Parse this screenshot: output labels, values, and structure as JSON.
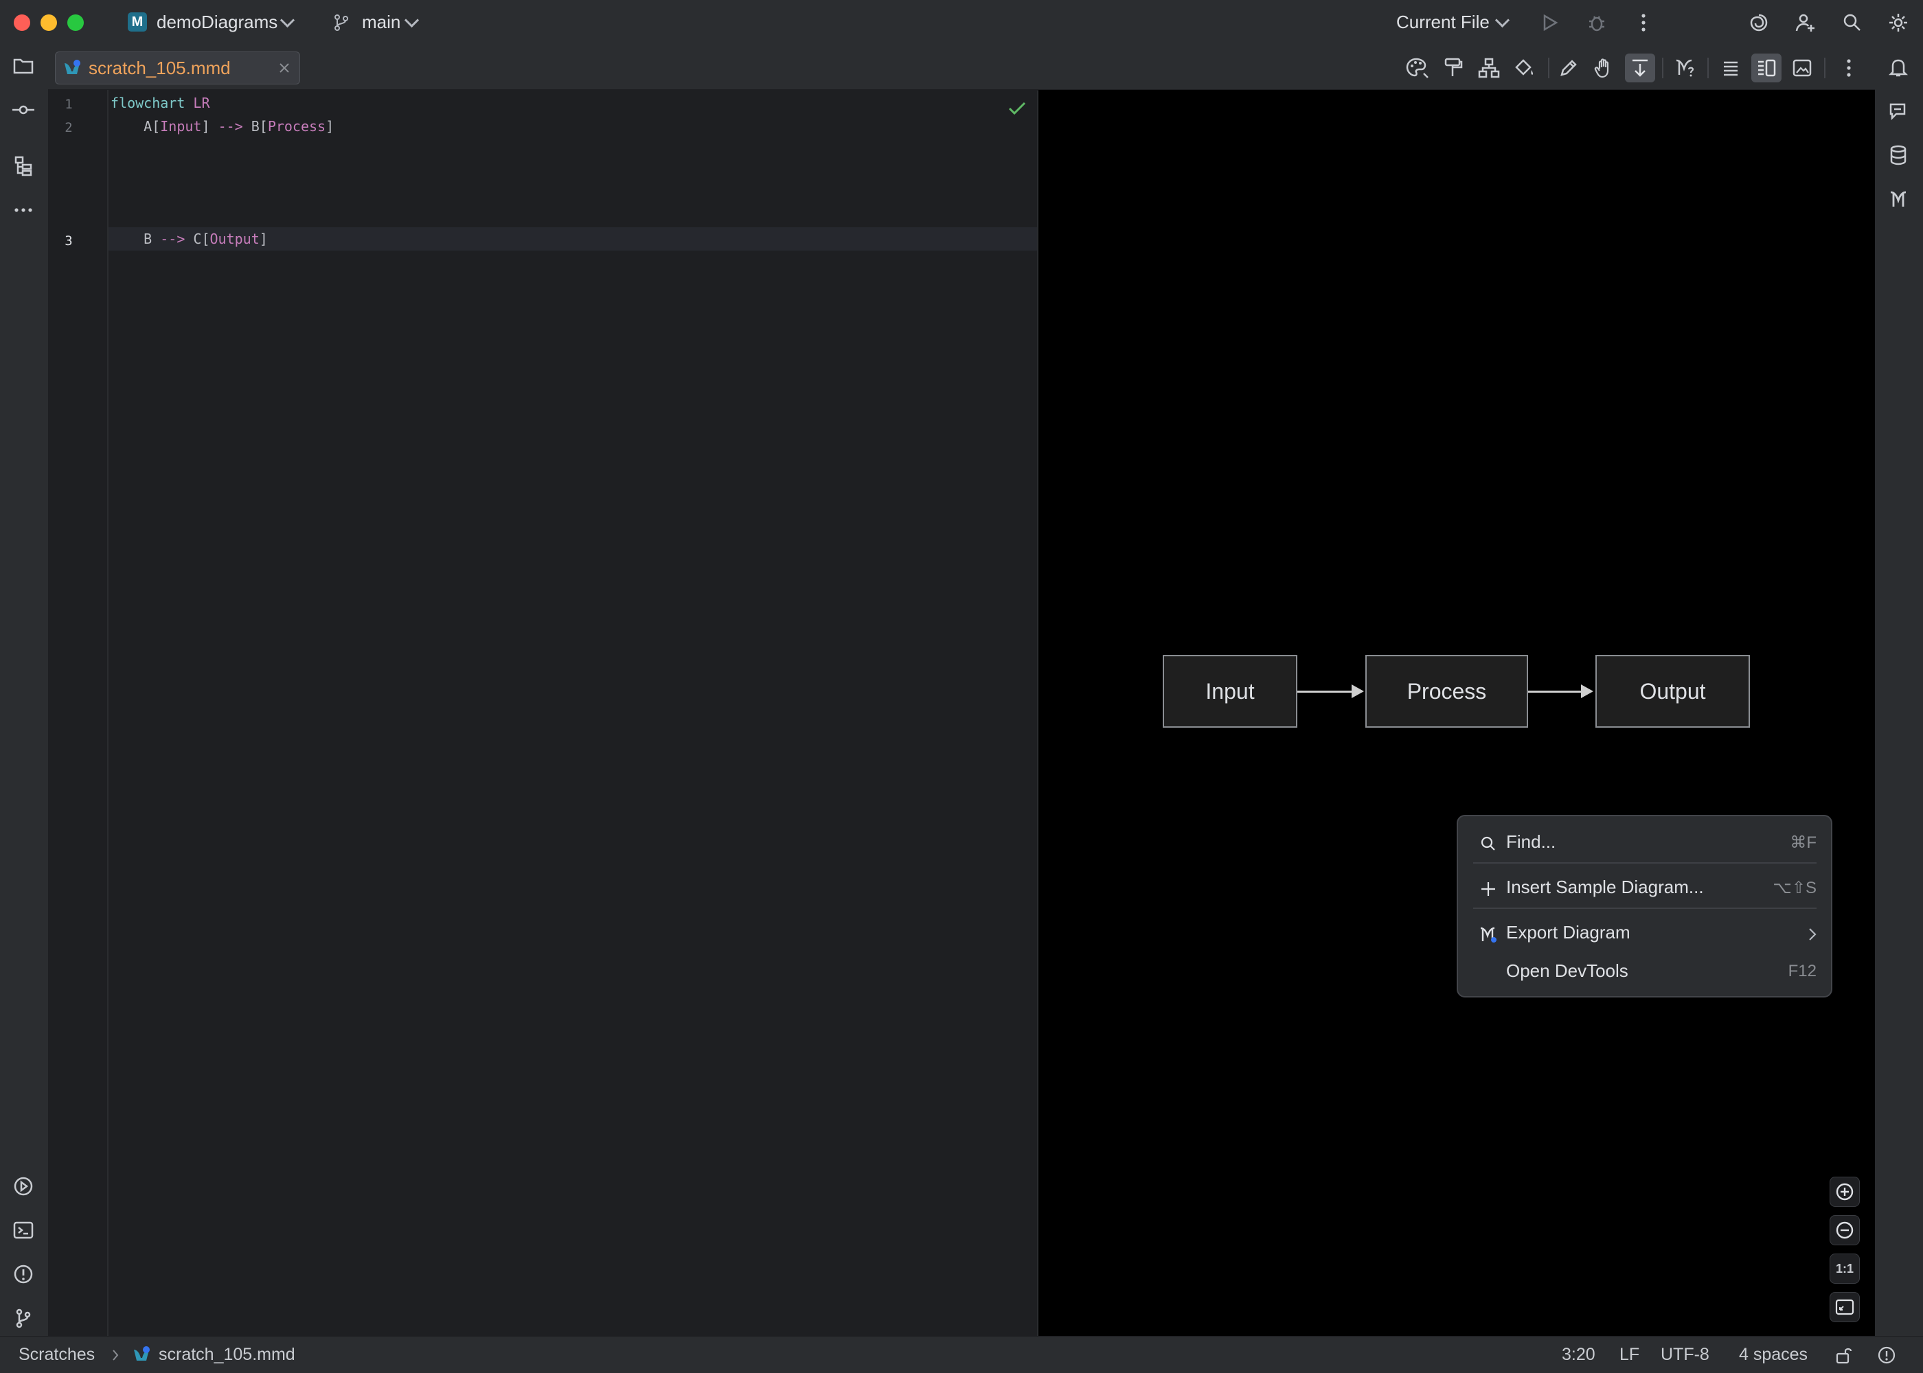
{
  "title_bar": {
    "project_name": "demoDiagrams",
    "branch": "main",
    "run_config": "Current File"
  },
  "tab": {
    "filename": "scratch_105.mmd"
  },
  "editor": {
    "lines": [
      {
        "num": "1",
        "tokens": [
          {
            "t": "flowchart",
            "c": "kw"
          },
          {
            "t": " ",
            "c": "ar"
          },
          {
            "t": "LR",
            "c": "sv"
          }
        ]
      },
      {
        "num": "2",
        "tokens": [
          {
            "t": "    A[",
            "c": "ar"
          },
          {
            "t": "Input",
            "c": "sv"
          },
          {
            "t": "] ",
            "c": "ar"
          },
          {
            "t": "-->",
            "c": "sv"
          },
          {
            "t": " B[",
            "c": "ar"
          },
          {
            "t": "Process",
            "c": "sv"
          },
          {
            "t": "]",
            "c": "ar"
          }
        ]
      },
      {
        "num": "3",
        "tokens": [
          {
            "t": "    B ",
            "c": "ar"
          },
          {
            "t": "-->",
            "c": "sv"
          },
          {
            "t": " C[",
            "c": "ar"
          },
          {
            "t": "Output",
            "c": "sv"
          },
          {
            "t": "]",
            "c": "ar"
          }
        ]
      }
    ]
  },
  "diagram": {
    "nodes": [
      "Input",
      "Process",
      "Output"
    ]
  },
  "context_menu": {
    "items": [
      {
        "label": "Find...",
        "shortcut": "⌘F",
        "icon": "search-icon"
      },
      {
        "label": "Insert Sample Diagram...",
        "shortcut": "⌥⇧S",
        "icon": "plus-icon"
      },
      {
        "label": "Export Diagram",
        "shortcut": "",
        "icon": "mermaid-logo-icon"
      },
      {
        "label": "Open DevTools",
        "shortcut": "F12",
        "icon": ""
      }
    ]
  },
  "zoom_controls": {
    "actual_size_label": "1:1"
  },
  "status_bar": {
    "breadcrumb_root": "Scratches",
    "breadcrumb_file": "scratch_105.mmd",
    "position": "3:20",
    "line_ending": "LF",
    "encoding": "UTF-8",
    "indent": "4 spaces"
  },
  "colors": {
    "accent": "#3574f0",
    "check": "#5fb865",
    "traffic_red": "#ff5f57",
    "traffic_yellow": "#febc2e",
    "traffic_green": "#28c840"
  }
}
